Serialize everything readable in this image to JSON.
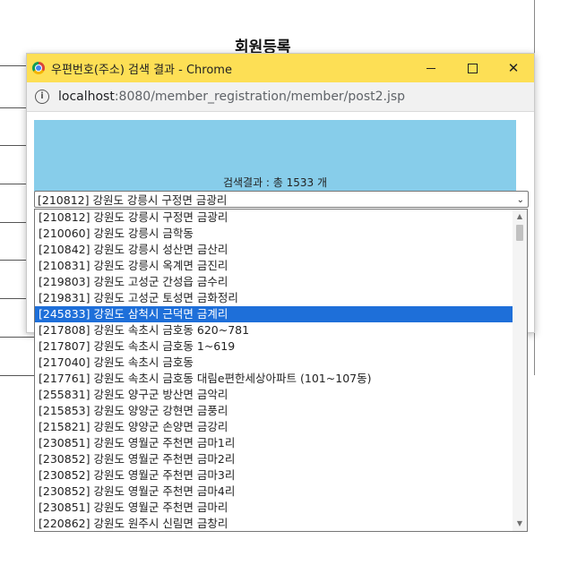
{
  "background": {
    "title": "회원등록"
  },
  "window": {
    "title": "우편번호(주소) 검색 결과 - Chrome",
    "controls": {
      "close": "✕"
    }
  },
  "address": {
    "host": "localhost",
    "path": ":8080/member_registration/member/post2.jsp"
  },
  "result": {
    "summary": "검색결과 : 총 1533 개"
  },
  "select": {
    "value": "[210812] 강원도 강릉시 구정면 금광리",
    "arrow": "⌄",
    "scroll_up": "▲",
    "scroll_down": "▼",
    "options": [
      {
        "label": "[210812] 강원도 강릉시 구정면 금광리"
      },
      {
        "label": "[210060] 강원도 강릉시 금학동"
      },
      {
        "label": "[210842] 강원도 강릉시 성산면 금산리"
      },
      {
        "label": "[210831] 강원도 강릉시 옥계면 금진리"
      },
      {
        "label": "[219803] 강원도 고성군 간성읍 금수리"
      },
      {
        "label": "[219831] 강원도 고성군 토성면 금화정리"
      },
      {
        "label": "[245833] 강원도 삼척시 근덕면 금계리",
        "selected": true
      },
      {
        "label": "[217808] 강원도 속초시 금호동 620~781"
      },
      {
        "label": "[217807] 강원도 속초시 금호동 1~619"
      },
      {
        "label": "[217040] 강원도 속초시 금호동"
      },
      {
        "label": "[217761] 강원도 속초시 금호동 대림e편한세상아파트 (101~107동)"
      },
      {
        "label": "[255831] 강원도 양구군 방산면 금악리"
      },
      {
        "label": "[215853] 강원도 양양군 강현면 금풍리"
      },
      {
        "label": "[215821] 강원도 양양군 손양면 금강리"
      },
      {
        "label": "[230851] 강원도 영월군 주천면 금마1리"
      },
      {
        "label": "[230852] 강원도 영월군 주천면 금마2리"
      },
      {
        "label": "[230852] 강원도 영월군 주천면 금마3리"
      },
      {
        "label": "[230852] 강원도 영월군 주천면 금마4리"
      },
      {
        "label": "[230851] 강원도 영월군 주천면 금마리"
      },
      {
        "label": "[220862] 강원도 원주시 신림면 금창리"
      }
    ]
  }
}
